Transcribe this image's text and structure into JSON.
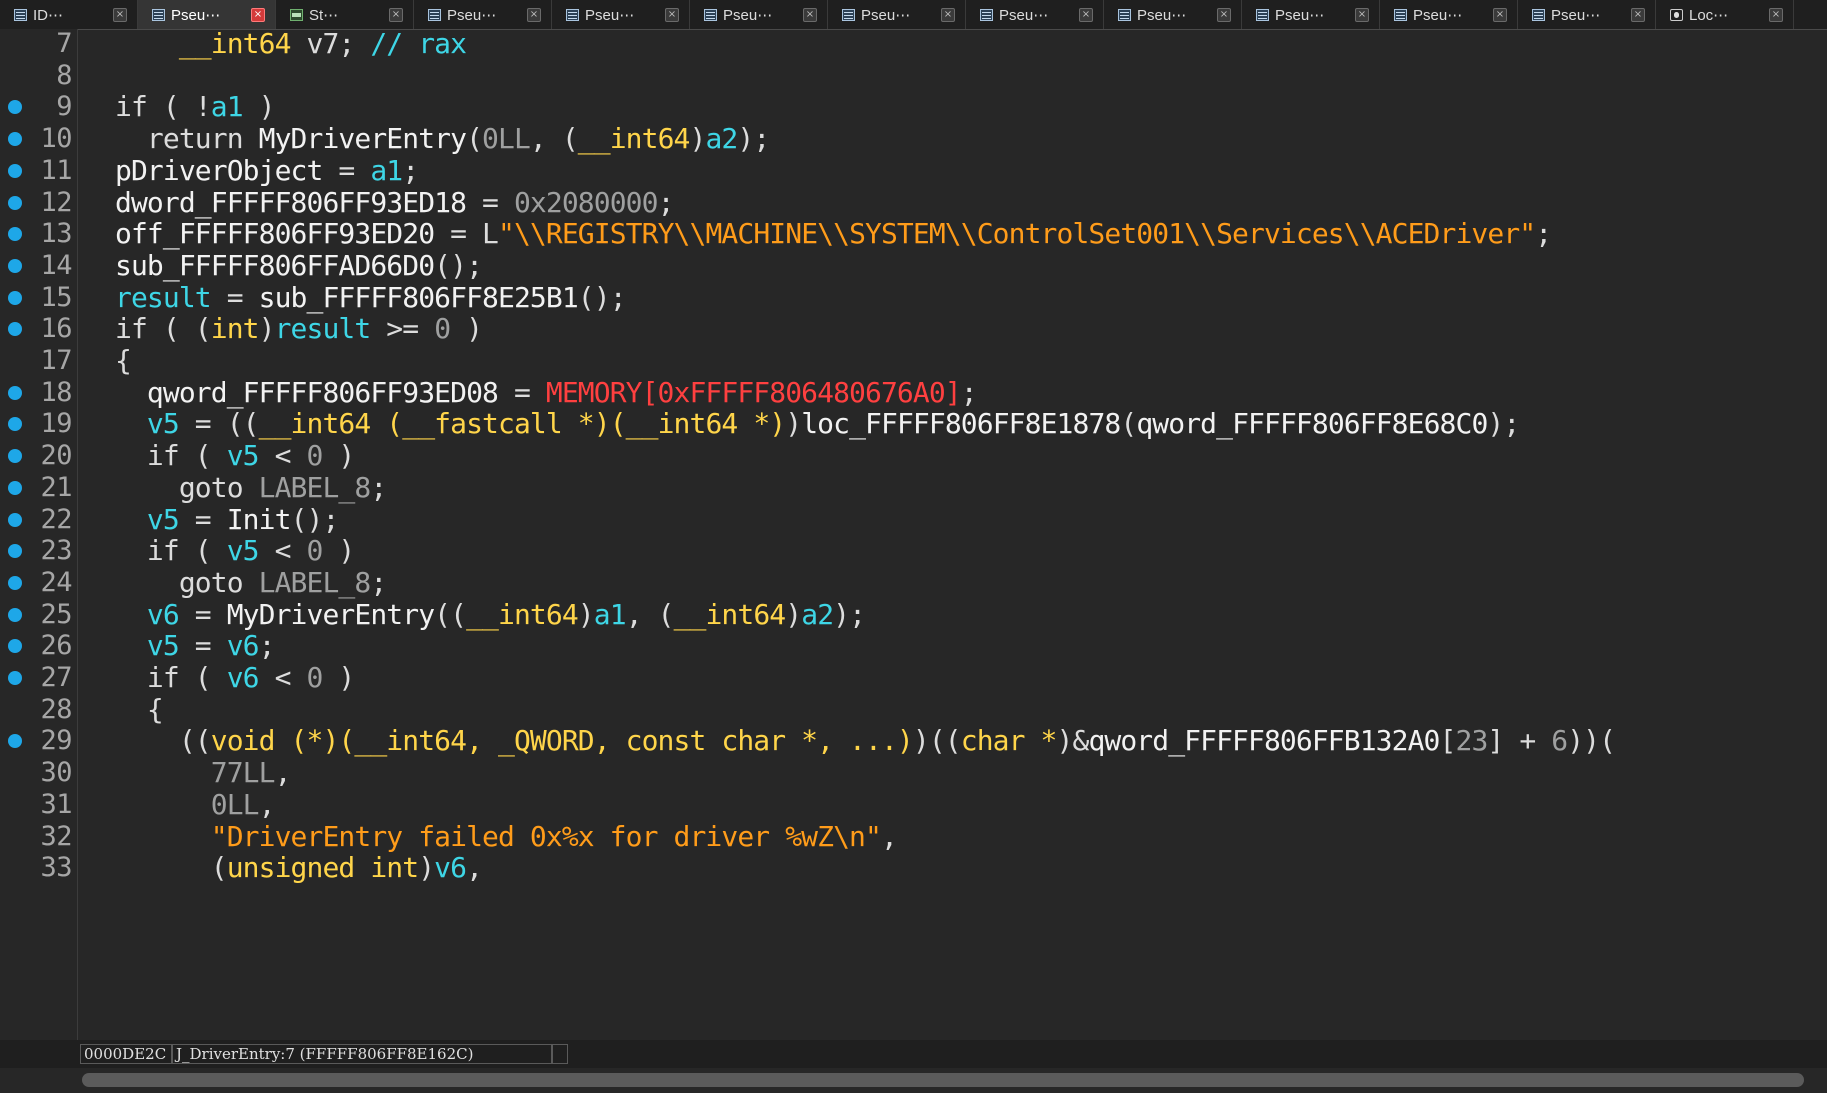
{
  "tabs": [
    {
      "label": "ID⋯",
      "icon": "view-icon",
      "active": false
    },
    {
      "label": "Pseu⋯",
      "icon": "view-icon",
      "active": true
    },
    {
      "label": "St⋯",
      "icon": "strings-icon",
      "active": false
    },
    {
      "label": "Pseu⋯",
      "icon": "view-icon",
      "active": false
    },
    {
      "label": "Pseu⋯",
      "icon": "view-icon",
      "active": false
    },
    {
      "label": "Pseu⋯",
      "icon": "view-icon",
      "active": false
    },
    {
      "label": "Pseu⋯",
      "icon": "view-icon",
      "active": false
    },
    {
      "label": "Pseu⋯",
      "icon": "view-icon",
      "active": false
    },
    {
      "label": "Pseu⋯",
      "icon": "view-icon",
      "active": false
    },
    {
      "label": "Pseu⋯",
      "icon": "view-icon",
      "active": false
    },
    {
      "label": "Pseu⋯",
      "icon": "view-icon",
      "active": false
    },
    {
      "label": "Pseu⋯",
      "icon": "view-icon",
      "active": false
    },
    {
      "label": "Loc⋯",
      "icon": "locals-icon",
      "active": false
    }
  ],
  "tab_close_glyph": "×",
  "code": {
    "breakpoint_color": "#1ea7e8",
    "lines": [
      {
        "num": "7",
        "bp": false,
        "tokens": [
          [
            "    ",
            "p"
          ],
          [
            "__int64",
            "y"
          ],
          [
            " v7; ",
            "p"
          ],
          [
            "// rax",
            "c"
          ]
        ]
      },
      {
        "num": "8",
        "bp": false,
        "tokens": []
      },
      {
        "num": "9",
        "bp": true,
        "tokens": [
          [
            "if ( !",
            "k"
          ],
          [
            "a1",
            "v"
          ],
          [
            " )",
            "p"
          ]
        ]
      },
      {
        "num": "10",
        "bp": true,
        "tokens": [
          [
            "  return ",
            "k"
          ],
          [
            "MyDriverEntry",
            "f"
          ],
          [
            "(",
            "p"
          ],
          [
            "0LL",
            "n"
          ],
          [
            ", (",
            "p"
          ],
          [
            "__int64",
            "y"
          ],
          [
            ")",
            "p"
          ],
          [
            "a2",
            "v"
          ],
          [
            ");",
            "p"
          ]
        ]
      },
      {
        "num": "11",
        "bp": true,
        "tokens": [
          [
            "pDriverObject",
            "f"
          ],
          [
            " = ",
            "p"
          ],
          [
            "a1",
            "v"
          ],
          [
            ";",
            "p"
          ]
        ]
      },
      {
        "num": "12",
        "bp": true,
        "tokens": [
          [
            "dword_FFFFF806FF93ED18",
            "f"
          ],
          [
            " = ",
            "p"
          ],
          [
            "0x2080000",
            "n"
          ],
          [
            ";",
            "p"
          ]
        ]
      },
      {
        "num": "13",
        "bp": true,
        "tokens": [
          [
            "off_FFFFF806FF93ED20",
            "f"
          ],
          [
            " = L",
            "p"
          ],
          [
            "\"\\\\REGISTRY\\\\MACHINE\\\\SYSTEM\\\\ControlSet001\\\\Services\\\\ACEDriver\"",
            "s"
          ],
          [
            ";",
            "p"
          ]
        ]
      },
      {
        "num": "14",
        "bp": true,
        "tokens": [
          [
            "sub_FFFFF806FFAD66D0",
            "f"
          ],
          [
            "();",
            "p"
          ]
        ]
      },
      {
        "num": "15",
        "bp": true,
        "tokens": [
          [
            "result",
            "v"
          ],
          [
            " = ",
            "p"
          ],
          [
            "sub_FFFFF806FF8E25B1",
            "f"
          ],
          [
            "();",
            "p"
          ]
        ]
      },
      {
        "num": "16",
        "bp": true,
        "tokens": [
          [
            "if ( (",
            "k"
          ],
          [
            "int",
            "y"
          ],
          [
            ")",
            "p"
          ],
          [
            "result",
            "v"
          ],
          [
            " >= ",
            "p"
          ],
          [
            "0",
            "n"
          ],
          [
            " )",
            "p"
          ]
        ]
      },
      {
        "num": "17",
        "bp": false,
        "tokens": [
          [
            "{",
            "p"
          ]
        ]
      },
      {
        "num": "18",
        "bp": true,
        "tokens": [
          [
            "  qword_FFFFF806FF93ED08",
            "f"
          ],
          [
            " = ",
            "p"
          ],
          [
            "MEMORY[0xFFFFF806480676A0]",
            "m"
          ],
          [
            ";",
            "p"
          ]
        ]
      },
      {
        "num": "19",
        "bp": true,
        "tokens": [
          [
            "  ",
            "p"
          ],
          [
            "v5",
            "v"
          ],
          [
            " = ((",
            "p"
          ],
          [
            "__int64 (__fastcall *)(__int64 *)",
            "y"
          ],
          [
            ")",
            "p"
          ],
          [
            "loc_FFFFF806FF8E1878",
            "f"
          ],
          [
            "(",
            "p"
          ],
          [
            "qword_FFFFF806FF8E68C0",
            "f"
          ],
          [
            ");",
            "p"
          ]
        ]
      },
      {
        "num": "20",
        "bp": true,
        "tokens": [
          [
            "  if ( ",
            "k"
          ],
          [
            "v5",
            "v"
          ],
          [
            " < ",
            "p"
          ],
          [
            "0",
            "n"
          ],
          [
            " )",
            "p"
          ]
        ]
      },
      {
        "num": "21",
        "bp": true,
        "tokens": [
          [
            "    goto ",
            "k"
          ],
          [
            "LABEL_8",
            "n"
          ],
          [
            ";",
            "p"
          ]
        ]
      },
      {
        "num": "22",
        "bp": true,
        "tokens": [
          [
            "  ",
            "p"
          ],
          [
            "v5",
            "v"
          ],
          [
            " = ",
            "p"
          ],
          [
            "Init",
            "f"
          ],
          [
            "();",
            "p"
          ]
        ]
      },
      {
        "num": "23",
        "bp": true,
        "tokens": [
          [
            "  if ( ",
            "k"
          ],
          [
            "v5",
            "v"
          ],
          [
            " < ",
            "p"
          ],
          [
            "0",
            "n"
          ],
          [
            " )",
            "p"
          ]
        ]
      },
      {
        "num": "24",
        "bp": true,
        "tokens": [
          [
            "    goto ",
            "k"
          ],
          [
            "LABEL_8",
            "n"
          ],
          [
            ";",
            "p"
          ]
        ]
      },
      {
        "num": "25",
        "bp": true,
        "tokens": [
          [
            "  ",
            "p"
          ],
          [
            "v6",
            "v"
          ],
          [
            " = ",
            "p"
          ],
          [
            "MyDriverEntry",
            "f"
          ],
          [
            "((",
            "p"
          ],
          [
            "__int64",
            "y"
          ],
          [
            ")",
            "p"
          ],
          [
            "a1",
            "v"
          ],
          [
            ", (",
            "p"
          ],
          [
            "__int64",
            "y"
          ],
          [
            ")",
            "p"
          ],
          [
            "a2",
            "v"
          ],
          [
            ");",
            "p"
          ]
        ]
      },
      {
        "num": "26",
        "bp": true,
        "tokens": [
          [
            "  ",
            "p"
          ],
          [
            "v5",
            "v"
          ],
          [
            " = ",
            "p"
          ],
          [
            "v6",
            "v"
          ],
          [
            ";",
            "p"
          ]
        ]
      },
      {
        "num": "27",
        "bp": true,
        "tokens": [
          [
            "  if ( ",
            "k"
          ],
          [
            "v6",
            "v"
          ],
          [
            " < ",
            "p"
          ],
          [
            "0",
            "n"
          ],
          [
            " )",
            "p"
          ]
        ]
      },
      {
        "num": "28",
        "bp": false,
        "tokens": [
          [
            "  {",
            "p"
          ]
        ]
      },
      {
        "num": "29",
        "bp": true,
        "tokens": [
          [
            "    ((",
            "p"
          ],
          [
            "void (*)(__int64, _QWORD, const char *, ...)",
            "y"
          ],
          [
            ")((",
            "p"
          ],
          [
            "char *",
            "y"
          ],
          [
            ")&",
            "p"
          ],
          [
            "qword_FFFFF806FFB132A0",
            "f"
          ],
          [
            "[",
            "p"
          ],
          [
            "23",
            "n"
          ],
          [
            "] + ",
            "p"
          ],
          [
            "6",
            "n"
          ],
          [
            "))(",
            "p"
          ]
        ]
      },
      {
        "num": "30",
        "bp": false,
        "tokens": [
          [
            "      ",
            "p"
          ],
          [
            "77LL",
            "n"
          ],
          [
            ",",
            "p"
          ]
        ]
      },
      {
        "num": "31",
        "bp": false,
        "tokens": [
          [
            "      ",
            "p"
          ],
          [
            "0LL",
            "n"
          ],
          [
            ",",
            "p"
          ]
        ]
      },
      {
        "num": "32",
        "bp": false,
        "tokens": [
          [
            "      ",
            "p"
          ],
          [
            "\"DriverEntry failed 0x%x for driver %wZ\\n\"",
            "s"
          ],
          [
            ",",
            "p"
          ]
        ]
      },
      {
        "num": "33",
        "bp": false,
        "tokens": [
          [
            "      (",
            "p"
          ],
          [
            "unsigned int",
            "y"
          ],
          [
            ")",
            "p"
          ],
          [
            "v6",
            "v"
          ],
          [
            ",",
            "p"
          ]
        ]
      }
    ]
  },
  "status": {
    "address": "0000DE2C",
    "location": "J_DriverEntry:7 (FFFFF806FF8E162C)"
  }
}
